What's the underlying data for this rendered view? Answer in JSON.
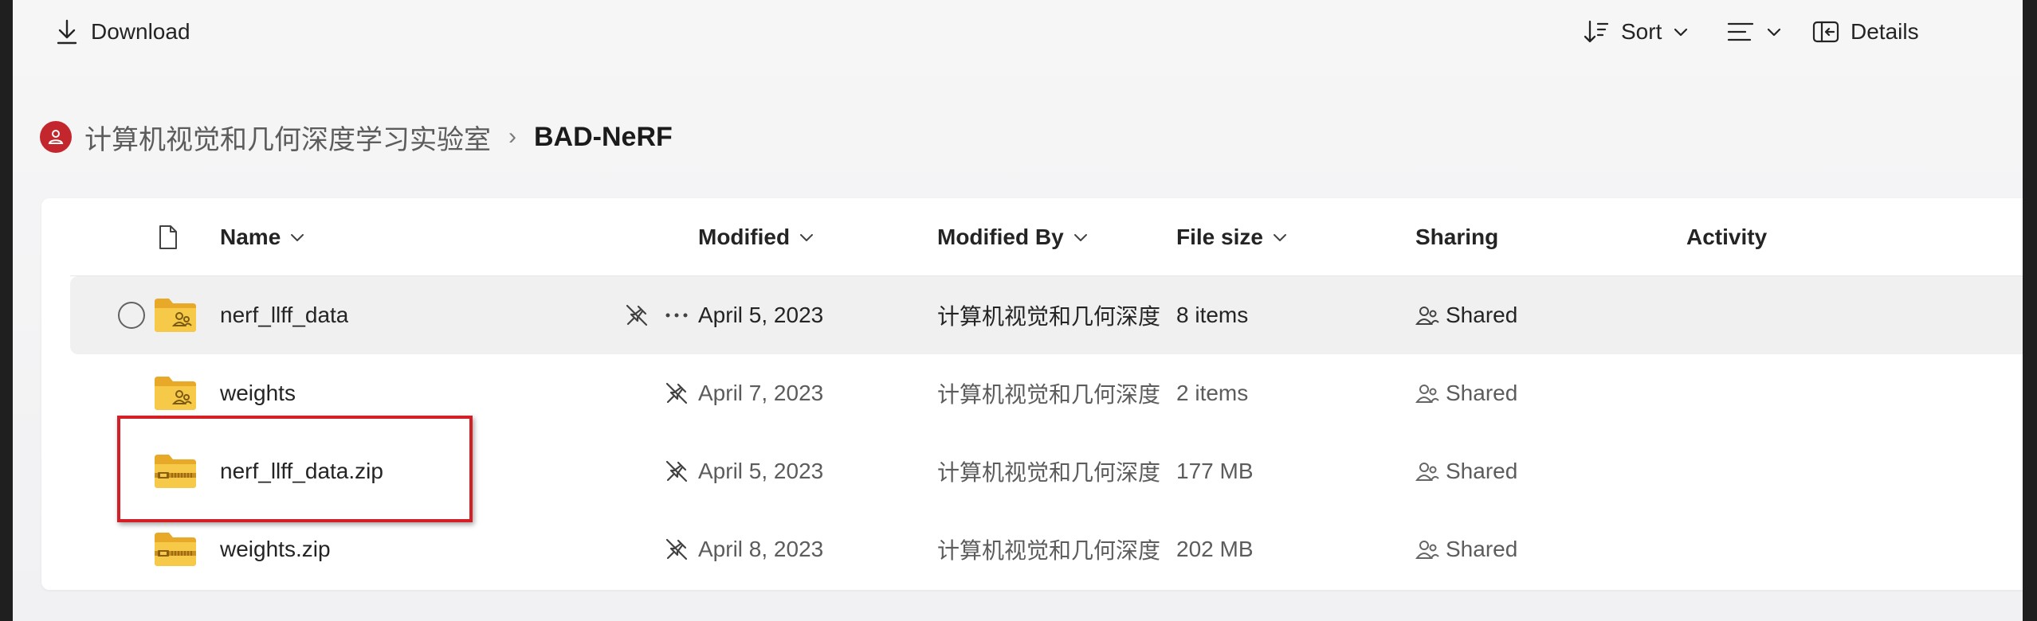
{
  "toolbar": {
    "download_label": "Download",
    "sort_label": "Sort",
    "details_label": "Details"
  },
  "breadcrumb": {
    "site": "计算机视觉和几何深度学习实验室",
    "current": "BAD-NeRF"
  },
  "columns": {
    "name": "Name",
    "modified": "Modified",
    "modified_by": "Modified By",
    "file_size": "File size",
    "sharing": "Sharing",
    "activity": "Activity"
  },
  "rows": [
    {
      "name": "nerf_llff_data",
      "type": "shared-folder",
      "modified": "April 5, 2023",
      "modified_by": "计算机视觉和几何深度",
      "size": "8 items",
      "sharing": "Shared"
    },
    {
      "name": "weights",
      "type": "shared-folder",
      "modified": "April 7, 2023",
      "modified_by": "计算机视觉和几何深度",
      "size": "2 items",
      "sharing": "Shared"
    },
    {
      "name": "nerf_llff_data.zip",
      "type": "zip-folder",
      "modified": "April 5, 2023",
      "modified_by": "计算机视觉和几何深度",
      "size": "177 MB",
      "sharing": "Shared"
    },
    {
      "name": "weights.zip",
      "type": "zip-folder",
      "modified": "April 8, 2023",
      "modified_by": "计算机视觉和几何深度",
      "size": "202 MB",
      "sharing": "Shared"
    }
  ],
  "colors": {
    "highlight_box": "#d51f26",
    "site_badge": "#c4262e",
    "folder": "#f5c342"
  }
}
